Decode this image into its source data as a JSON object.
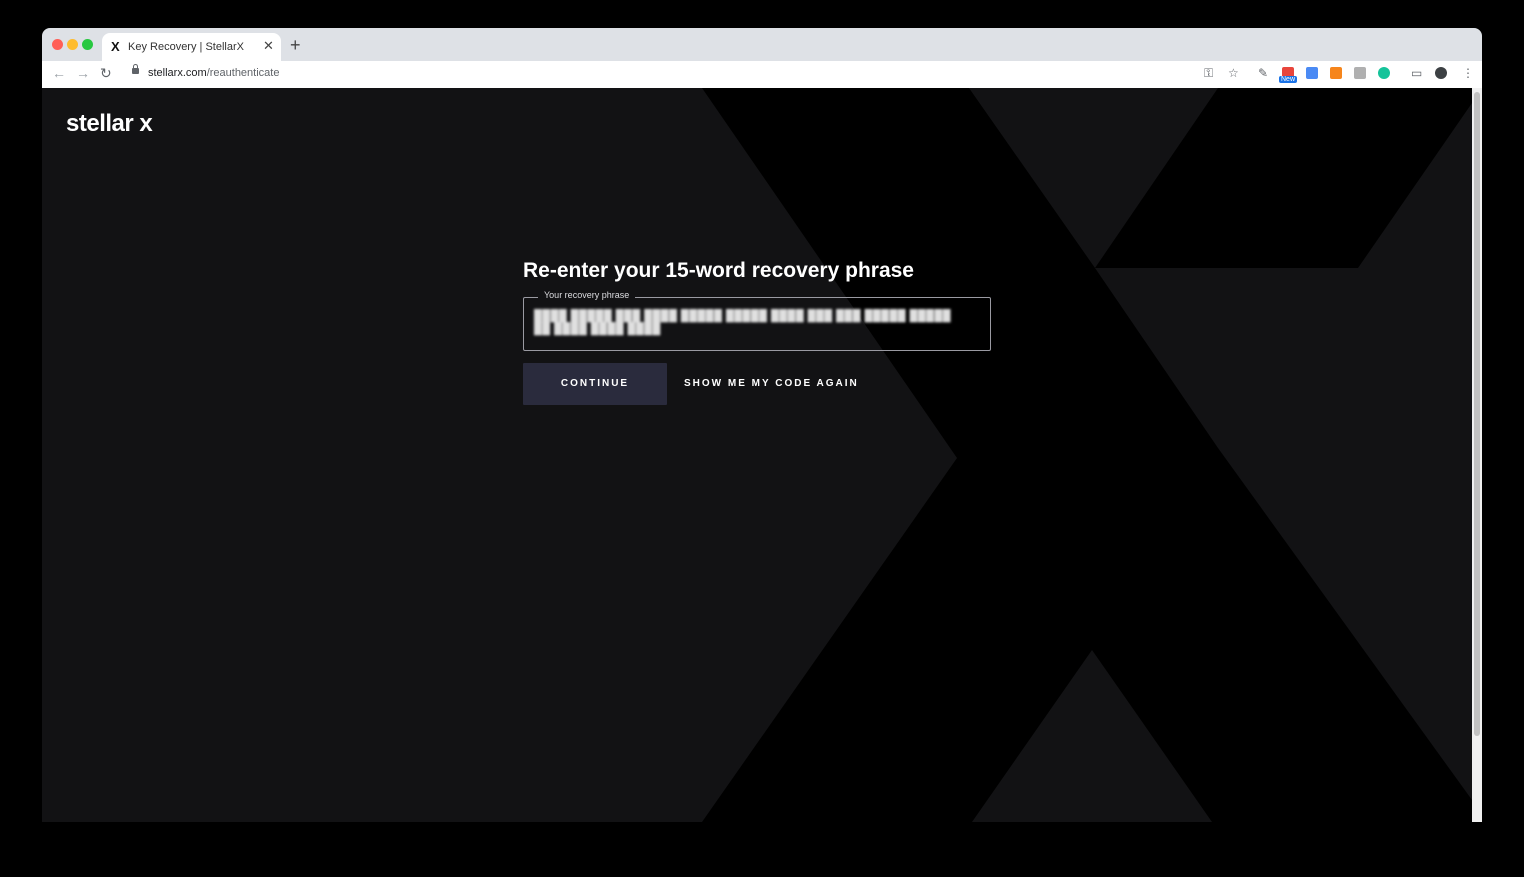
{
  "browser": {
    "tab_title": "Key Recovery | StellarX",
    "tab_favicon": "X",
    "url_host": "stellarx.com",
    "url_path": "/reauthenticate",
    "extension_badge": "New"
  },
  "page": {
    "logo": "stellar x",
    "heading": "Re-enter your 15-word recovery phrase",
    "field_label": "Your recovery phrase",
    "field_value": "████ █████ ███ ████ █████ █████ ████ ███ ███ █████ ███████ ████ ████ ████",
    "continue_label": "CONTINUE",
    "show_code_label": "SHOW ME MY CODE AGAIN"
  },
  "colors": {
    "background": "#121214",
    "x_shape": "#000000",
    "button": "#2a2b3d",
    "text": "#ffffff"
  }
}
